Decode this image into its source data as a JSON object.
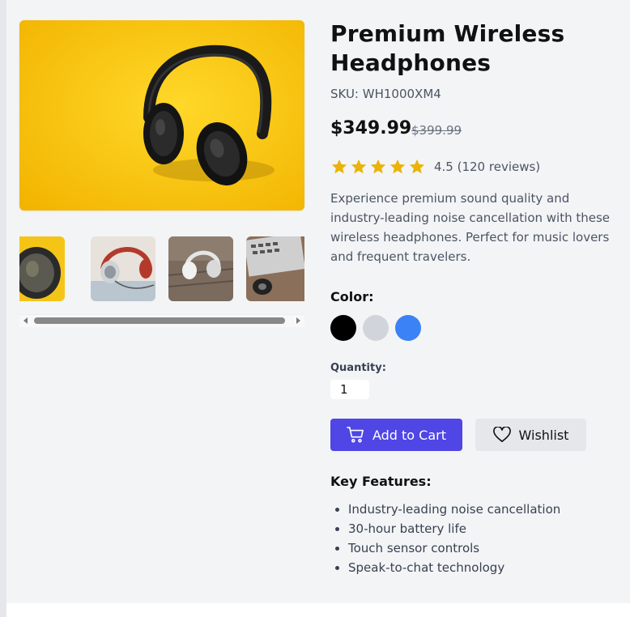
{
  "product": {
    "title": "Premium Wireless Headphones",
    "sku": "SKU: WH1000XM4",
    "price": "$349.99",
    "original_price": "$399.99",
    "rating_value": 4.5,
    "rating_text": "4.5 (120 reviews)",
    "stars_shown": 5,
    "description": "Experience premium sound quality and industry-leading noise cancellation with these wireless headphones. Perfect for music lovers and frequent travelers."
  },
  "gallery": {
    "main_image": "headphones-on-yellow",
    "thumbnails": [
      "headphones-closeup-yellow",
      "headphones-silver-red",
      "headphones-on-wood",
      "headphones-laptop-desk"
    ]
  },
  "color": {
    "label": "Color:",
    "options": [
      {
        "name": "Black",
        "hex": "#000000"
      },
      {
        "name": "Silver",
        "hex": "#d1d5db"
      },
      {
        "name": "Blue",
        "hex": "#3b82f6"
      }
    ]
  },
  "quantity": {
    "label": "Quantity:",
    "value": "1"
  },
  "actions": {
    "add_to_cart": "Add to Cart",
    "wishlist": "Wishlist",
    "cart_icon": "cart-icon",
    "heart_icon": "heart-icon"
  },
  "features": {
    "title": "Key Features:",
    "items": [
      "Industry-leading noise cancellation",
      "30-hour battery life",
      "Touch sensor controls",
      "Speak-to-chat technology"
    ]
  },
  "theme": {
    "accent": "#4f46e5",
    "star": "#eab308"
  }
}
